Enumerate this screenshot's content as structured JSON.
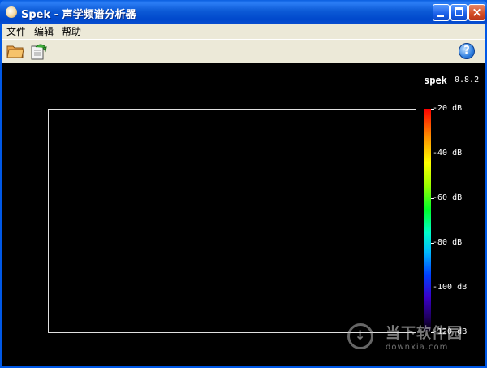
{
  "window": {
    "title": "Spek - 声学频谱分析器"
  },
  "menu": {
    "items": [
      "文件",
      "编辑",
      "帮助"
    ]
  },
  "toolbar": {
    "open_icon": "folder-open-icon",
    "reload_icon": "reload-icon",
    "help_icon": "help-icon",
    "help_glyph": "?"
  },
  "spectrogram": {
    "brand": "spek",
    "version": "0.8.2",
    "db_scale": [
      "-20 dB",
      "-40 dB",
      "-60 dB",
      "-80 dB",
      "-100 dB",
      "-120 dB"
    ]
  },
  "watermark": {
    "text": "当下软件园",
    "url": "downxia.com"
  },
  "colors": {
    "title_bar": "#0058e6",
    "canvas_bg": "#000000",
    "menu_bg": "#ece9d8"
  }
}
